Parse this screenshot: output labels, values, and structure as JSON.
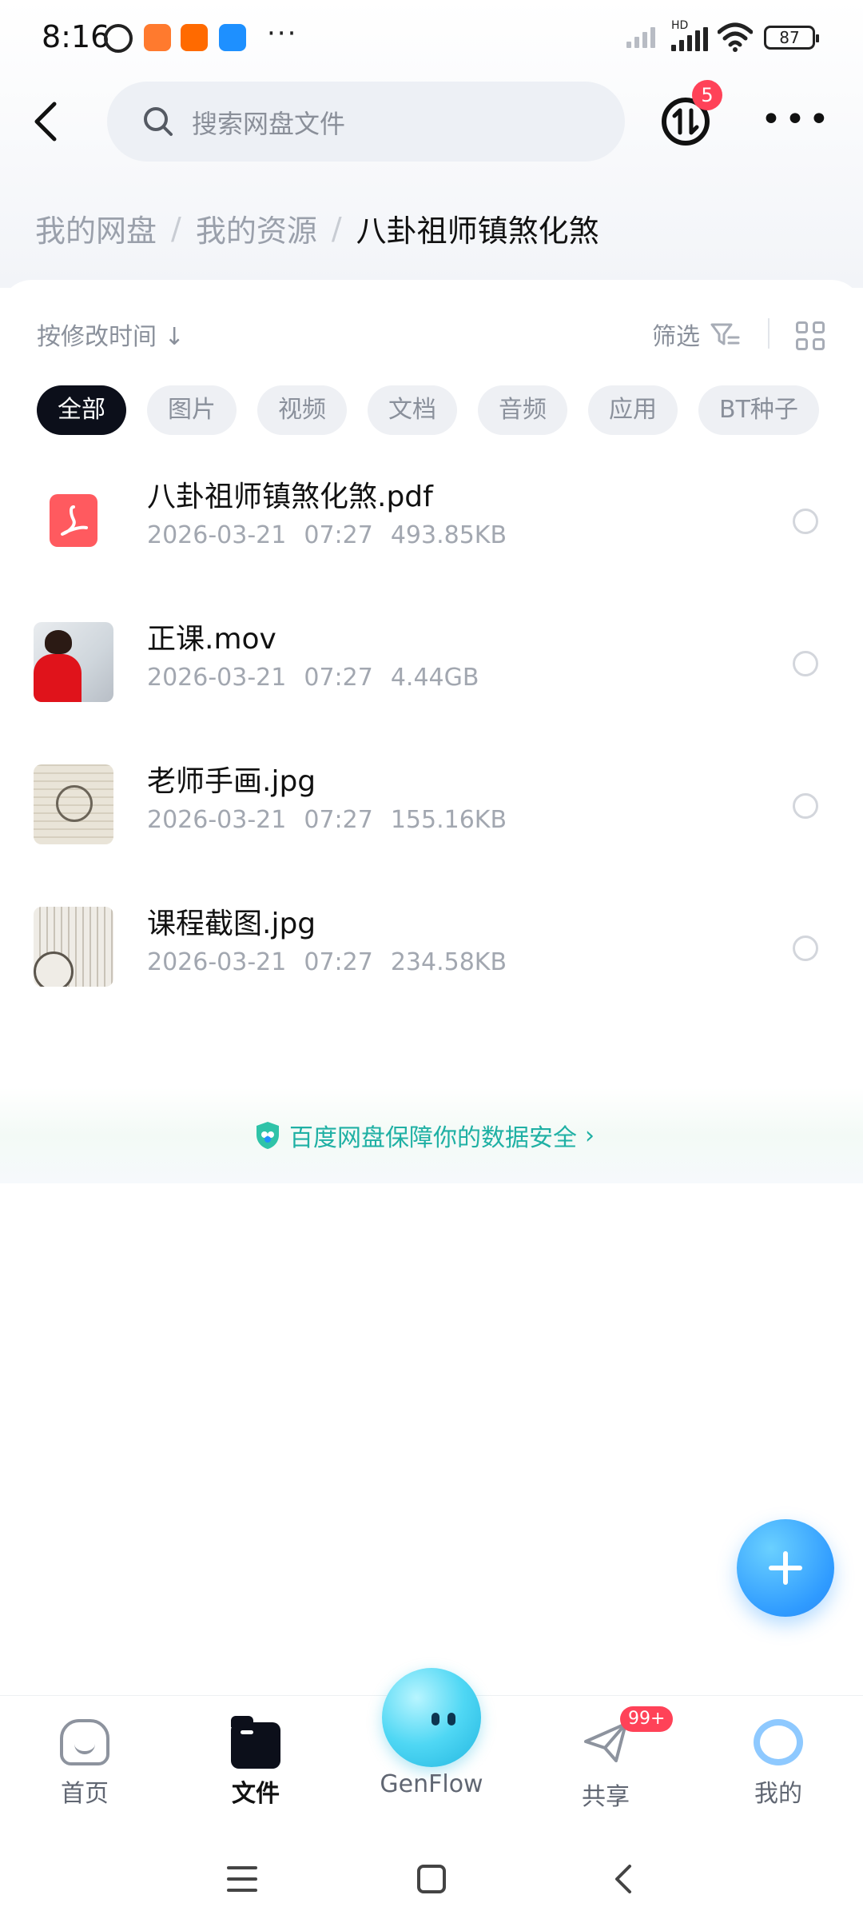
{
  "status_bar": {
    "time": "8:16",
    "battery": "87",
    "network_label": "HD"
  },
  "header": {
    "search_placeholder": "搜索网盘文件",
    "transfer_badge": "5"
  },
  "breadcrumb": {
    "items": [
      "我的网盘",
      "我的资源",
      "八卦祖师镇煞化煞"
    ],
    "separator": "/"
  },
  "toolbar": {
    "sort_label": "按修改时间 ↓",
    "filter_label": "筛选"
  },
  "filter_chips": [
    "全部",
    "图片",
    "视频",
    "文档",
    "音频",
    "应用",
    "BT种子"
  ],
  "active_chip": "全部",
  "files": [
    {
      "name": "八卦祖师镇煞化煞.pdf",
      "date": "2026-03-21",
      "time": "07:27",
      "size": "493.85KB",
      "type": "pdf"
    },
    {
      "name": "正课.mov",
      "date": "2026-03-21",
      "time": "07:27",
      "size": "4.44GB",
      "type": "video"
    },
    {
      "name": "老师手画.jpg",
      "date": "2026-03-21",
      "time": "07:27",
      "size": "155.16KB",
      "type": "image"
    },
    {
      "name": "课程截图.jpg",
      "date": "2026-03-21",
      "time": "07:27",
      "size": "234.58KB",
      "type": "image"
    }
  ],
  "safety_banner": {
    "text": "百度网盘保障你的数据安全",
    "chevron": "›"
  },
  "tabbar": {
    "home": "首页",
    "files": "文件",
    "genflow": "GenFlow",
    "share": "共享",
    "share_badge": "99+",
    "me": "我的"
  },
  "colors": {
    "accent_blue": "#2f9bff",
    "badge_red": "#ff4258",
    "safety_teal": "#1fb0a4",
    "active_chip_bg": "#0c0f1a"
  }
}
